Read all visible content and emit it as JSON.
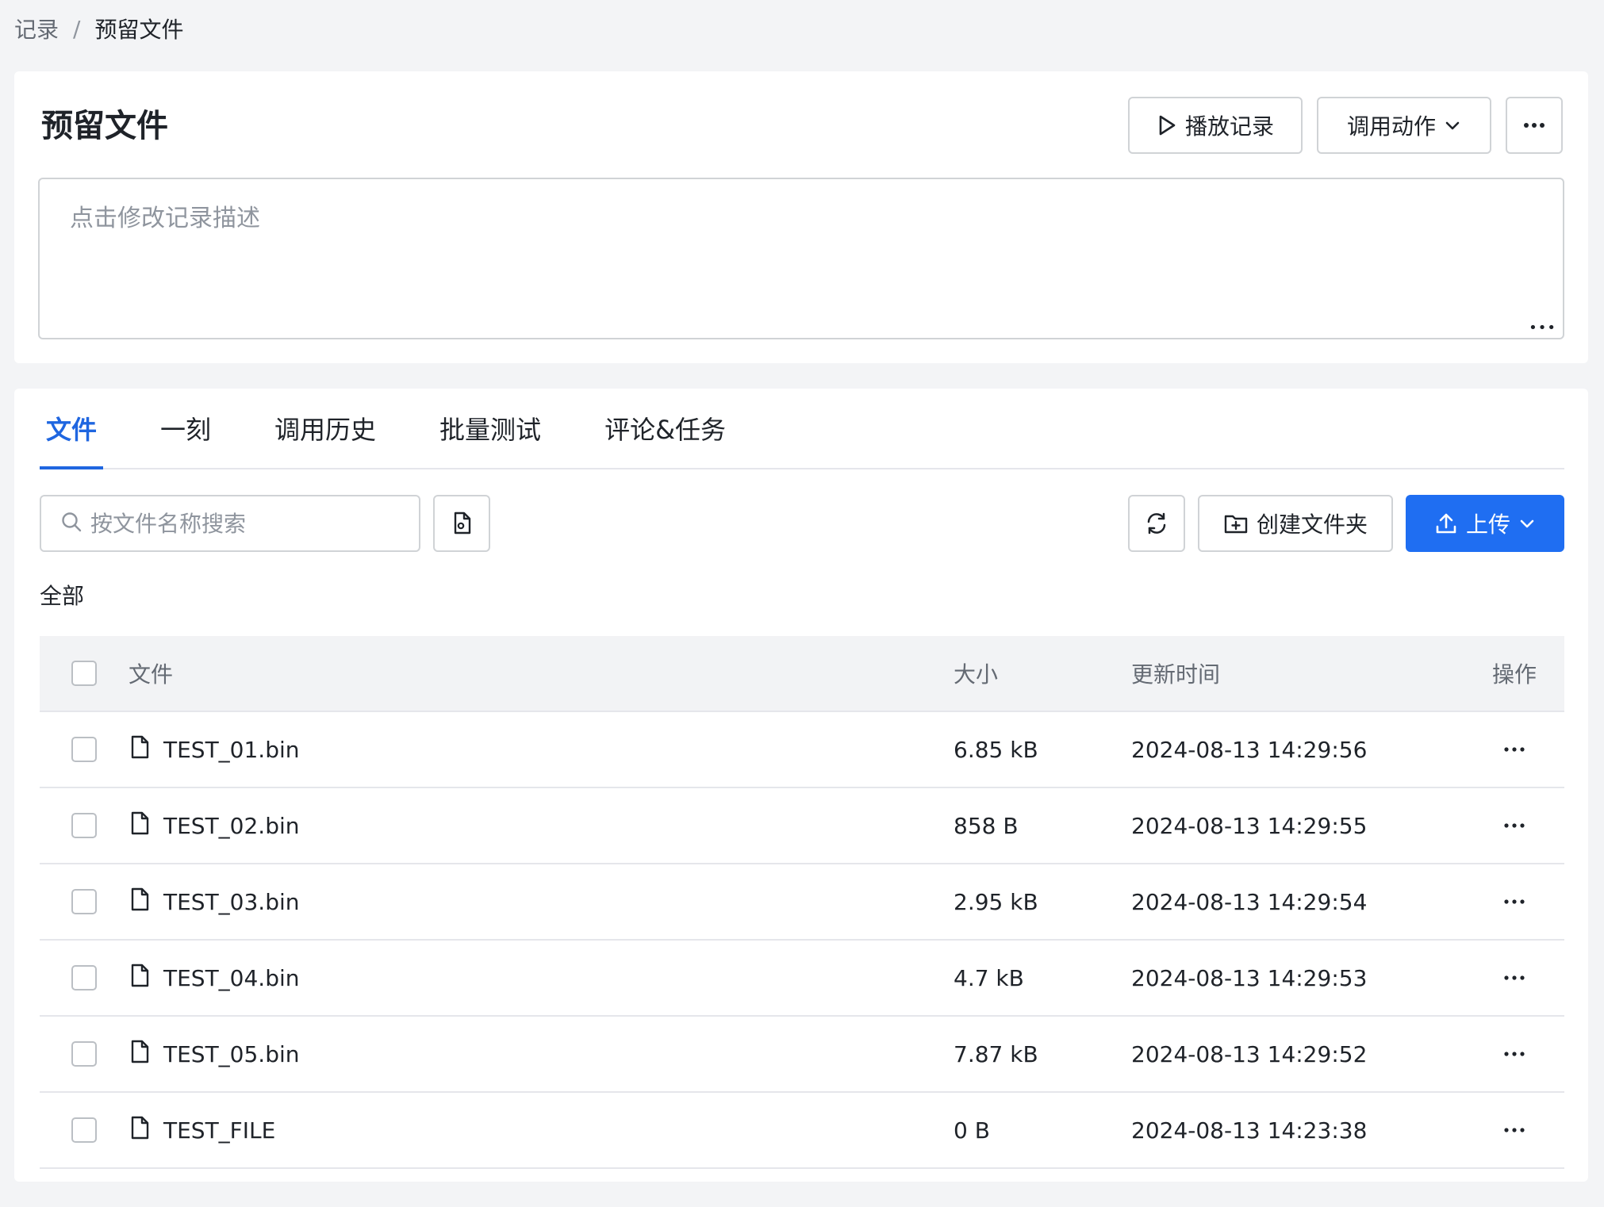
{
  "breadcrumb": {
    "root": "记录",
    "separator": "/",
    "current": "预留文件"
  },
  "header": {
    "title": "预留文件",
    "play_label": "播放记录",
    "call_label": "调用动作"
  },
  "description": {
    "placeholder": "点击修改记录描述"
  },
  "tabs": [
    {
      "label": "文件",
      "active": true
    },
    {
      "label": "一刻"
    },
    {
      "label": "调用历史"
    },
    {
      "label": "批量测试"
    },
    {
      "label": "评论&任务"
    }
  ],
  "toolbar": {
    "search_placeholder": "按文件名称搜索",
    "create_folder_label": "创建文件夹",
    "upload_label": "上传"
  },
  "path_label": "全部",
  "table": {
    "headers": {
      "name": "文件",
      "size": "大小",
      "time": "更新时间",
      "ops": "操作"
    },
    "rows": [
      {
        "name": "TEST_01.bin",
        "size": "6.85 kB",
        "time": "2024-08-13 14:29:56"
      },
      {
        "name": "TEST_02.bin",
        "size": "858 B",
        "time": "2024-08-13 14:29:55"
      },
      {
        "name": "TEST_03.bin",
        "size": "2.95 kB",
        "time": "2024-08-13 14:29:54"
      },
      {
        "name": "TEST_04.bin",
        "size": "4.7 kB",
        "time": "2024-08-13 14:29:53"
      },
      {
        "name": "TEST_05.bin",
        "size": "7.87 kB",
        "time": "2024-08-13 14:29:52"
      },
      {
        "name": "TEST_FILE",
        "size": "0 B",
        "time": "2024-08-13 14:23:38"
      }
    ]
  },
  "colors": {
    "accent": "#1f6ef2",
    "active_tab": "#1f66e0",
    "header_bg": "#f2f3f5",
    "page_bg": "#f3f4f6"
  }
}
